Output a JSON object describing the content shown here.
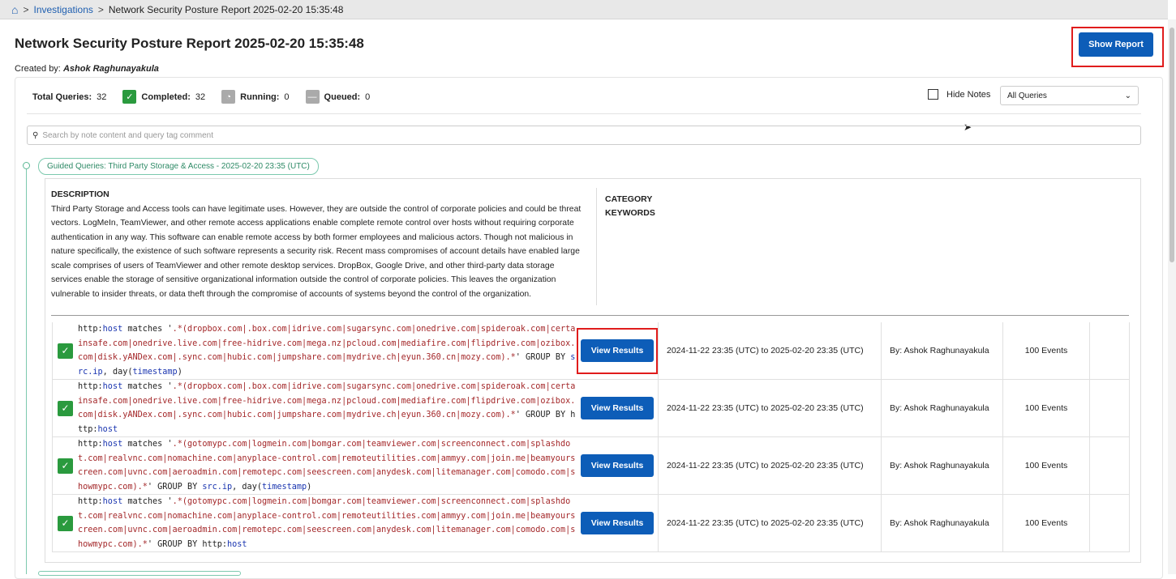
{
  "breadcrumb": {
    "home_icon": "home-icon",
    "items": [
      "Investigations",
      "Network Security Posture Report 2025-02-20 15:35:48"
    ]
  },
  "title": "Network Security Posture Report 2025-02-20 15:35:48",
  "created_by_label": "Created by:",
  "created_by": "Ashok Raghunayakula",
  "show_report": "Show Report",
  "stats": {
    "total_label": "Total Queries:",
    "total": "32",
    "completed_label": "Completed:",
    "completed": "32",
    "running_label": "Running:",
    "running": "0",
    "queued_label": "Queued:",
    "queued": "0"
  },
  "hide_notes": "Hide Notes",
  "filter": {
    "selected": "All Queries"
  },
  "search": {
    "placeholder": "Search by note content and query tag comment"
  },
  "group": {
    "tag": "Guided Queries: Third Party Storage & Access - 2025-02-20 23:35 (UTC)",
    "description_heading": "DESCRIPTION",
    "description": "Third Party Storage and Access tools can have legitimate uses. However, they are outside the control of corporate policies and could be threat vectors. LogMeIn, TeamViewer, and other remote access applications enable complete remote control over hosts without requiring corporate authentication in any way. This software can enable remote access by both former employees and malicious actors. Though not malicious in nature specifically, the existence of such software represents a security risk. Recent mass compromises of account details have enabled large scale comprises of users of TeamViewer and other remote desktop services. DropBox, Google Drive, and other third-party data storage services enable the storage of sensitive organizational information outside the control of corporate policies. This leaves the organization vulnerable to insider threats, or data theft through the compromise of accounts of systems beyond the control of the organization.",
    "category_label": "CATEGORY",
    "keywords_label": "KEYWORDS"
  },
  "queries": [
    {
      "segments": [
        [
          "",
          "http:"
        ],
        [
          "k",
          "host"
        ],
        [
          "",
          " matches '"
        ],
        [
          "s",
          ".*(dropbox.com|.box.com|idrive.com|sugarsync.com|onedrive.com|spideroak.com|certainsafe.com|onedrive.live.com|free-hidrive.com|mega.nz|pcloud.com|mediafire.com|flipdrive.com|ozibox.com|disk.yANDex.com|.sync.com|hubic.com|jumpshare.com|mydrive.ch|eyun.360.cn|mozy.com).*"
        ],
        [
          "",
          "' GROUP BY "
        ],
        [
          "k",
          "src.ip"
        ],
        [
          "",
          ", day("
        ],
        [
          "k",
          "timestamp"
        ],
        [
          "",
          ")"
        ]
      ],
      "button": "View Results",
      "range": "2024-11-22 23:35 (UTC) to 2025-02-20 23:35 (UTC)",
      "by": "By: Ashok Raghunayakula",
      "events": "100 Events"
    },
    {
      "segments": [
        [
          "",
          "http:"
        ],
        [
          "k",
          "host"
        ],
        [
          "",
          " matches '"
        ],
        [
          "s",
          ".*(dropbox.com|.box.com|idrive.com|sugarsync.com|onedrive.com|spideroak.com|certainsafe.com|onedrive.live.com|free-hidrive.com|mega.nz|pcloud.com|mediafire.com|flipdrive.com|ozibox.com|disk.yANDex.com|.sync.com|hubic.com|jumpshare.com|mydrive.ch|eyun.360.cn|mozy.com).*"
        ],
        [
          "",
          "' GROUP BY http:"
        ],
        [
          "k",
          "host"
        ]
      ],
      "button": "View Results",
      "range": "2024-11-22 23:35 (UTC) to 2025-02-20 23:35 (UTC)",
      "by": "By: Ashok Raghunayakula",
      "events": "100 Events"
    },
    {
      "segments": [
        [
          "",
          "http:"
        ],
        [
          "k",
          "host"
        ],
        [
          "",
          " matches '"
        ],
        [
          "s",
          ".*(gotomypc.com|logmein.com|bomgar.com|teamviewer.com|screenconnect.com|splashdot.com|realvnc.com|nomachine.com|anyplace-control.com|remoteutilities.com|ammyy.com|join.me|beamyourscreen.com|uvnc.com|aeroadmin.com|remotepc.com|seescreen.com|anydesk.com|litemanager.com|comodo.com|showmypc.com).*"
        ],
        [
          "",
          "' GROUP BY "
        ],
        [
          "k",
          "src.ip"
        ],
        [
          "",
          ", day("
        ],
        [
          "k",
          "timestamp"
        ],
        [
          "",
          ")"
        ]
      ],
      "button": "View Results",
      "range": "2024-11-22 23:35 (UTC) to 2025-02-20 23:35 (UTC)",
      "by": "By: Ashok Raghunayakula",
      "events": "100 Events"
    },
    {
      "segments": [
        [
          "",
          "http:"
        ],
        [
          "k",
          "host"
        ],
        [
          "",
          " matches '"
        ],
        [
          "s",
          ".*(gotomypc.com|logmein.com|bomgar.com|teamviewer.com|screenconnect.com|splashdot.com|realvnc.com|nomachine.com|anyplace-control.com|remoteutilities.com|ammyy.com|join.me|beamyourscreen.com|uvnc.com|aeroadmin.com|remotepc.com|seescreen.com|anydesk.com|litemanager.com|comodo.com|showmypc.com).*"
        ],
        [
          "",
          "' GROUP BY http:"
        ],
        [
          "k",
          "host"
        ]
      ],
      "button": "View Results",
      "range": "2024-11-22 23:35 (UTC) to 2025-02-20 23:35 (UTC)",
      "by": "By: Ashok Raghunayakula",
      "events": "100 Events"
    }
  ]
}
